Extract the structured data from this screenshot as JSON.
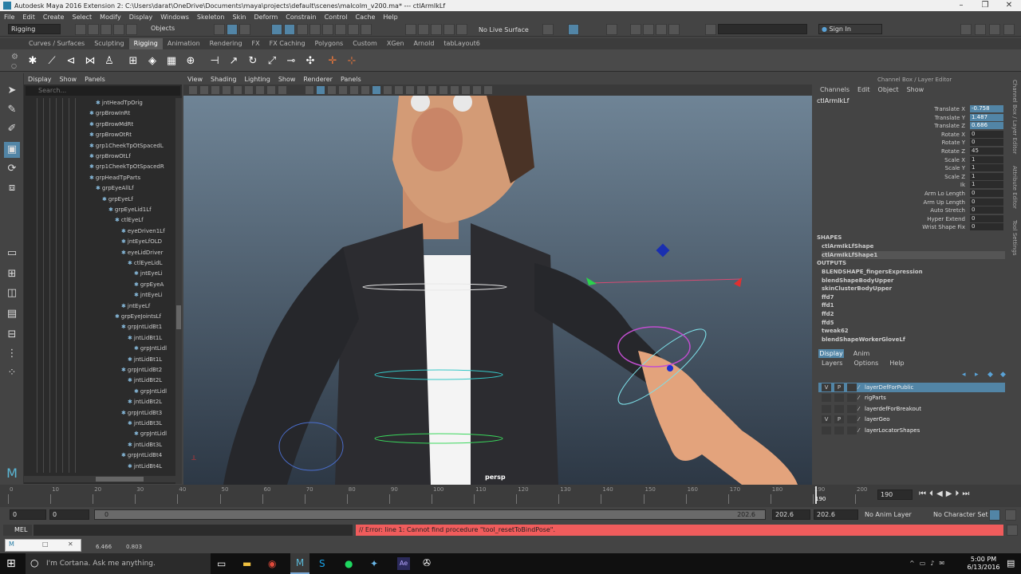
{
  "window": {
    "title": "Autodesk Maya 2016 Extension 2: C:\\Users\\darat\\OneDrive\\Documents\\maya\\projects\\default\\scenes\\malcolm_v200.ma*   ---   ctlArmIkLf"
  },
  "menu": [
    "File",
    "Edit",
    "Create",
    "Select",
    "Modify",
    "Display",
    "Windows",
    "Skeleton",
    "Skin",
    "Deform",
    "Constrain",
    "Control",
    "Cache",
    "Help"
  ],
  "status": {
    "menuset": "Rigging",
    "select_mode": "Objects",
    "live_surface": "No Live Surface",
    "sign_in": "Sign In"
  },
  "shelf_tabs": [
    "Curves / Surfaces",
    "Sculpting",
    "Rigging",
    "Animation",
    "Rendering",
    "FX",
    "FX Caching",
    "Polygons",
    "Custom",
    "XGen",
    "Arnold",
    "tabLayout6"
  ],
  "shelf_active": "Rigging",
  "outliner": {
    "menu": [
      "Display",
      "Show",
      "Panels"
    ],
    "search_placeholder": "Search...",
    "rows": [
      "jntHeadTpOrig",
      "grpBrowInRt",
      "grpBrowMdRt",
      "grpBrowOtRt",
      "grp1CheekTpOtSpacedL",
      "grpBrowOtLf",
      "grp1CheekTpOtSpacedR",
      "grpHeadTpParts",
      "grpEyeAllLf",
      "grpEyeLf",
      "grpEyeLid1Lf",
      "ctlEyeLf",
      "eyeDriven1Lf",
      "jntEyeLfOLD",
      "eyeLidDriver",
      "ctlEyeLidL",
      "jntEyeLi",
      "grpEyeA",
      "jntEyeLi",
      "jntEyeLf",
      "grpEyeJointsLf",
      "grpJntLidBt1",
      "jntLidBt1L",
      "grpJntLidl",
      "jntLidBt1L",
      "grpJntLidBt2",
      "jntLidBt2L",
      "grpJntLidl",
      "jntLidBt2L",
      "grpJntLidBt3",
      "jntLidBt3L",
      "grpJntLidl",
      "jntLidBt3L",
      "grpJntLidBt4",
      "jntLidBt4L"
    ]
  },
  "viewport": {
    "menu": [
      "View",
      "Shading",
      "Lighting",
      "Show",
      "Renderer",
      "Panels"
    ],
    "camera_label": "persp"
  },
  "channel_box": {
    "header": "Channel Box / Layer Editor",
    "menu": [
      "Channels",
      "Edit",
      "Object",
      "Show"
    ],
    "object": "ctlArmIkLf",
    "channels": [
      {
        "label": "Translate X",
        "value": "-0.758",
        "selected": true
      },
      {
        "label": "Translate Y",
        "value": "1.487",
        "selected": true
      },
      {
        "label": "Translate Z",
        "value": "0.686",
        "selected": true
      },
      {
        "label": "Rotate X",
        "value": "0"
      },
      {
        "label": "Rotate Y",
        "value": "0"
      },
      {
        "label": "Rotate Z",
        "value": "45"
      },
      {
        "label": "Scale X",
        "value": "1"
      },
      {
        "label": "Scale Y",
        "value": "1"
      },
      {
        "label": "Scale Z",
        "value": "1"
      },
      {
        "label": "Ik",
        "value": "1"
      },
      {
        "label": "Arm Lo Length",
        "value": "0"
      },
      {
        "label": "Arm Up Length",
        "value": "0"
      },
      {
        "label": "Auto Stretch",
        "value": "0"
      },
      {
        "label": "Hyper Extend",
        "value": "0"
      },
      {
        "label": "Wrist Shape Fix",
        "value": "0"
      }
    ],
    "shapes_title": "SHAPES",
    "shapes": [
      "ctlArmIkLfShape",
      "ctlArmIkLfShape1"
    ],
    "outputs_title": "OUTPUTS",
    "outputs": [
      "BLENDSHAPE_fingersExpression",
      "blendShapeBodyUpper",
      "skinClusterBodyUpper",
      "ffd7",
      "ffd1",
      "ffd2",
      "ffd5",
      "tweak62",
      "blendShapeWorkerGloveLf"
    ]
  },
  "side_tabs": [
    "Channel Box / Layer Editor",
    "Attribute Editor",
    "Tool Settings"
  ],
  "layer_editor": {
    "tabs": [
      "Display",
      "Anim"
    ],
    "menu": [
      "Layers",
      "Options",
      "Help"
    ],
    "layers": [
      {
        "v": "V",
        "p": "P",
        "name": "layerDefForPublic",
        "selected": true
      },
      {
        "v": "",
        "p": "",
        "name": "rigParts"
      },
      {
        "v": "",
        "p": "",
        "name": "layerdefForBreakout"
      },
      {
        "v": "V",
        "p": "P",
        "name": "layerGeo"
      },
      {
        "v": "",
        "p": "",
        "name": "layerLocatorShapes"
      }
    ]
  },
  "timeline": {
    "ticks": [
      "0",
      "10",
      "20",
      "30",
      "40",
      "50",
      "60",
      "70",
      "80",
      "90",
      "100",
      "110",
      "120",
      "130",
      "140",
      "150",
      "160",
      "170",
      "180",
      "190",
      "200"
    ],
    "current": "190",
    "current_field": "190"
  },
  "range": {
    "start": "0",
    "start2": "0",
    "slider_start": "0",
    "slider_end": "202.6",
    "end": "202.6",
    "end2": "202.6",
    "anim_layer": "No Anim Layer",
    "char_set": "No Character Set"
  },
  "cmd": {
    "lang": "MEL",
    "error": "// Error: line 1: Cannot find procedure \"tool_resetToBindPose\"."
  },
  "help": {
    "v1": "6.466",
    "v2": "0.803"
  },
  "taskbar": {
    "cortana": "I'm Cortana. Ask me anything.",
    "time": "5:00 PM",
    "date": "6/13/2016"
  }
}
